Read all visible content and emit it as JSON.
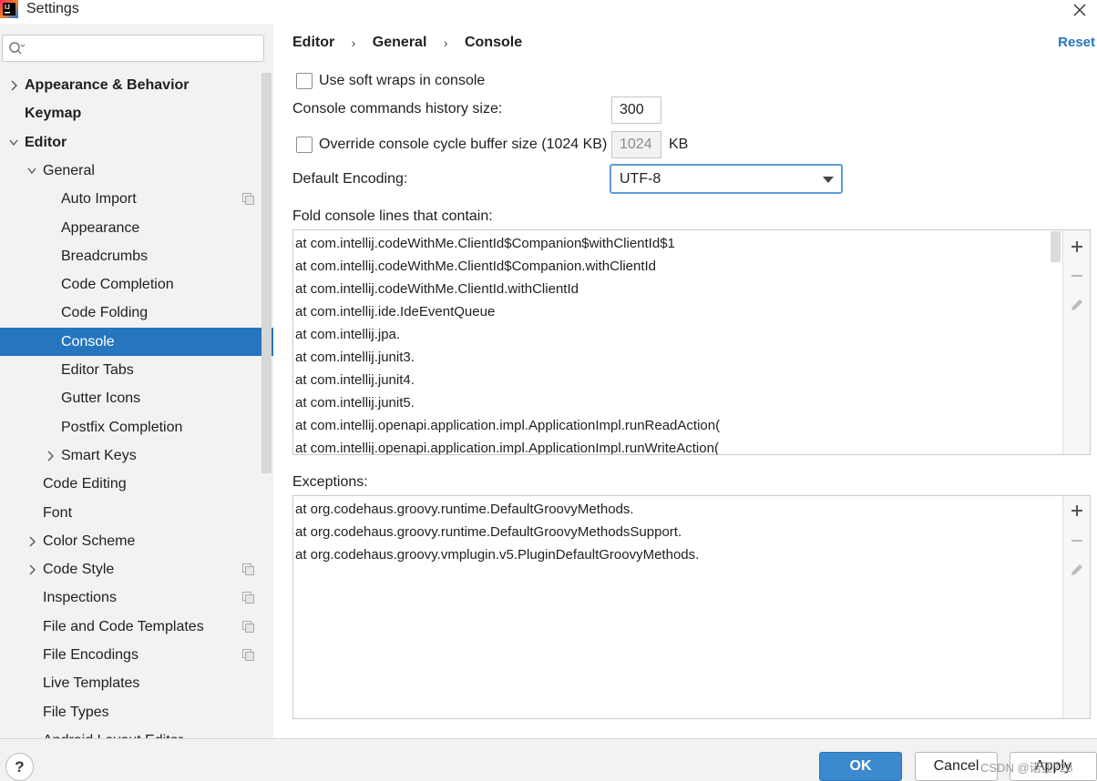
{
  "window": {
    "title": "Settings"
  },
  "search": {
    "placeholder": ""
  },
  "sidebar": {
    "items": [
      {
        "label": "Appearance & Behavior",
        "bold": true,
        "chevron": "right",
        "indent": 0
      },
      {
        "label": "Keymap",
        "bold": true,
        "chevron": "",
        "indent": 0
      },
      {
        "label": "Editor",
        "bold": true,
        "chevron": "down",
        "indent": 0
      },
      {
        "label": "General",
        "bold": false,
        "chevron": "down",
        "indent": 1
      },
      {
        "label": "Auto Import",
        "bold": false,
        "chevron": "",
        "indent": 2,
        "project_icon": true
      },
      {
        "label": "Appearance",
        "bold": false,
        "chevron": "",
        "indent": 2
      },
      {
        "label": "Breadcrumbs",
        "bold": false,
        "chevron": "",
        "indent": 2
      },
      {
        "label": "Code Completion",
        "bold": false,
        "chevron": "",
        "indent": 2
      },
      {
        "label": "Code Folding",
        "bold": false,
        "chevron": "",
        "indent": 2
      },
      {
        "label": "Console",
        "bold": false,
        "chevron": "",
        "indent": 2,
        "selected": true
      },
      {
        "label": "Editor Tabs",
        "bold": false,
        "chevron": "",
        "indent": 2
      },
      {
        "label": "Gutter Icons",
        "bold": false,
        "chevron": "",
        "indent": 2
      },
      {
        "label": "Postfix Completion",
        "bold": false,
        "chevron": "",
        "indent": 2
      },
      {
        "label": "Smart Keys",
        "bold": false,
        "chevron": "right",
        "indent": 2
      },
      {
        "label": "Code Editing",
        "bold": false,
        "chevron": "",
        "indent": 1
      },
      {
        "label": "Font",
        "bold": false,
        "chevron": "",
        "indent": 1
      },
      {
        "label": "Color Scheme",
        "bold": false,
        "chevron": "right",
        "indent": 1
      },
      {
        "label": "Code Style",
        "bold": false,
        "chevron": "right",
        "indent": 1,
        "project_icon": true
      },
      {
        "label": "Inspections",
        "bold": false,
        "chevron": "",
        "indent": 1,
        "project_icon": true
      },
      {
        "label": "File and Code Templates",
        "bold": false,
        "chevron": "",
        "indent": 1,
        "project_icon": true
      },
      {
        "label": "File Encodings",
        "bold": false,
        "chevron": "",
        "indent": 1,
        "project_icon": true
      },
      {
        "label": "Live Templates",
        "bold": false,
        "chevron": "",
        "indent": 1
      },
      {
        "label": "File Types",
        "bold": false,
        "chevron": "",
        "indent": 1
      },
      {
        "label": "Android Layout Editor",
        "bold": false,
        "chevron": "",
        "indent": 1
      }
    ]
  },
  "breadcrumb": {
    "part1": "Editor",
    "part2": "General",
    "part3": "Console",
    "separator": "›"
  },
  "reset_label": "Reset",
  "options": {
    "soft_wraps_label": "Use soft wraps in console",
    "soft_wraps_checked": false,
    "history_label": "Console commands history size:",
    "history_value": "300",
    "override_label": "Override console cycle buffer size (1024 KB)",
    "override_checked": false,
    "override_value": "1024",
    "override_unit": "KB",
    "encoding_label": "Default Encoding:",
    "encoding_value": "UTF-8"
  },
  "fold": {
    "label": "Fold console lines that contain:",
    "rows": [
      "at com.intellij.codeWithMe.ClientId$Companion$withClientId$1",
      "at com.intellij.codeWithMe.ClientId$Companion.withClientId",
      "at com.intellij.codeWithMe.ClientId.withClientId",
      "at com.intellij.ide.IdeEventQueue",
      "at com.intellij.jpa.",
      "at com.intellij.junit3.",
      "at com.intellij.junit4.",
      "at com.intellij.junit5.",
      "at com.intellij.openapi.application.impl.ApplicationImpl.runReadAction(",
      "at com.intellij.openapi.application.impl.ApplicationImpl.runWriteAction("
    ]
  },
  "exceptions": {
    "label": "Exceptions:",
    "rows": [
      "at org.codehaus.groovy.runtime.DefaultGroovyMethods.",
      "at org.codehaus.groovy.runtime.DefaultGroovyMethodsSupport.",
      "at org.codehaus.groovy.vmplugin.v5.PluginDefaultGroovyMethods."
    ]
  },
  "toolbar_icons": {
    "add": "plus-icon",
    "remove": "minus-icon",
    "edit": "pencil-icon"
  },
  "footer": {
    "help_label": "?",
    "ok_label": "OK",
    "cancel_label": "Cancel",
    "apply_label": "Apply",
    "watermark": "CSDN @诺亚728"
  },
  "colors": {
    "accent": "#2675bf",
    "selection": "#2675bf",
    "ok_button": "#3c89d0",
    "focus_border": "#5e9bd6"
  }
}
